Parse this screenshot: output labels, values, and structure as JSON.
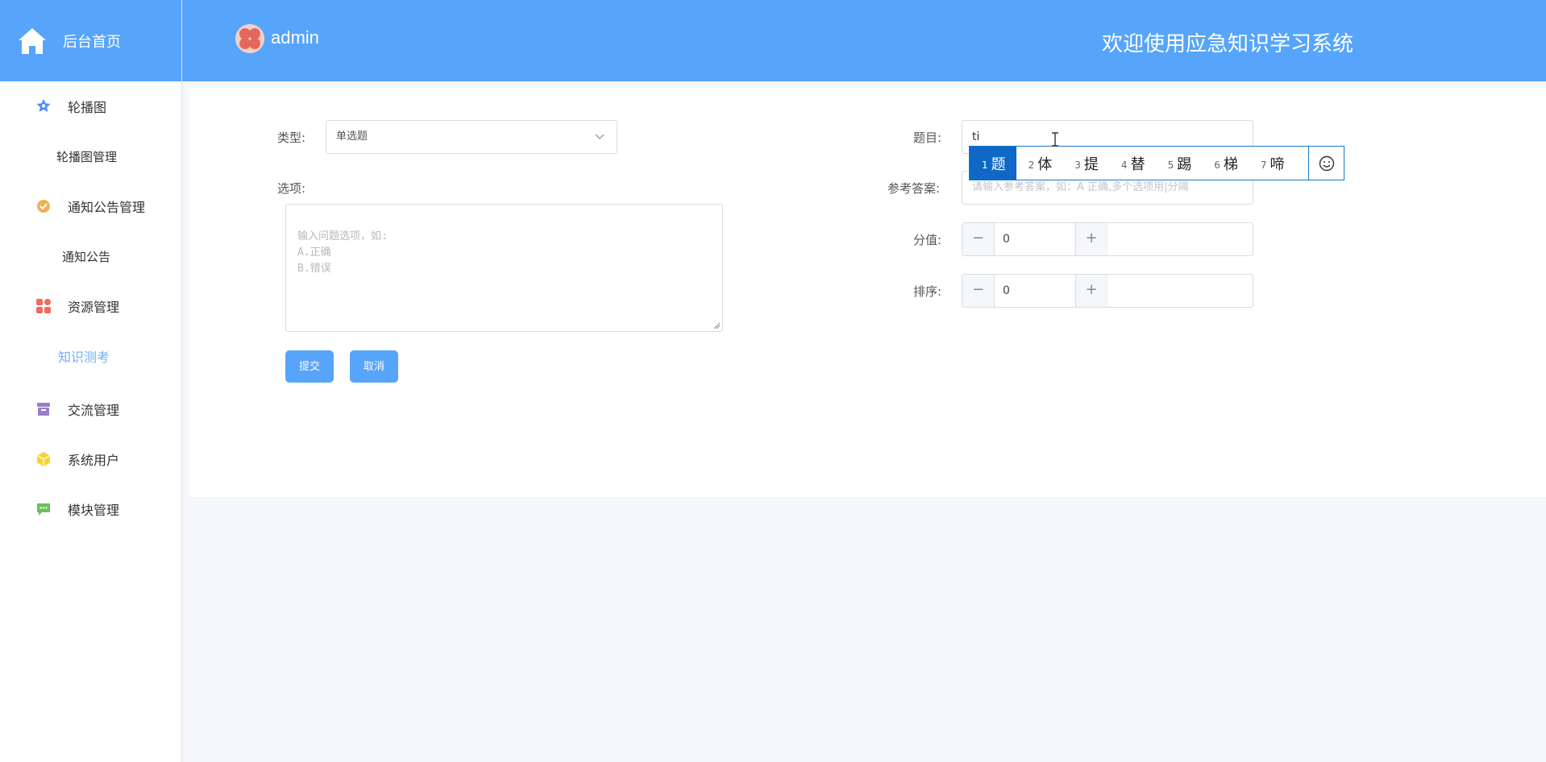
{
  "sidebar": {
    "home_label": "后台首页",
    "items": [
      {
        "label": "轮播图",
        "icon": "star-badge-icon",
        "color": "#4b8df8"
      },
      {
        "label": "轮播图管理",
        "sub": true
      },
      {
        "label": "通知公告管理",
        "icon": "gear-badge-icon",
        "color": "#f0b054"
      },
      {
        "label": "通知公告",
        "sub": true
      },
      {
        "label": "资源管理",
        "icon": "grid-apps-icon",
        "color": "#f06a5c"
      },
      {
        "label": "知识测考",
        "sub": true,
        "active": true
      },
      {
        "label": "交流管理",
        "icon": "archive-box-icon",
        "color": "#9a7fc8"
      },
      {
        "label": "系统用户",
        "icon": "cube-icon",
        "color": "#f5d631"
      },
      {
        "label": "模块管理",
        "icon": "chat-bubble-icon",
        "color": "#6ac259"
      }
    ]
  },
  "header": {
    "username": "admin",
    "welcome": "欢迎使用应急知识学习系统"
  },
  "form": {
    "type_label": "类型:",
    "type_value": "单选题",
    "options_label": "选项:",
    "options_placeholder": "输入问题选项，如:\nA.正确\nB.错误",
    "submit": "提交",
    "cancel": "取消",
    "question_label": "题目:",
    "question_value": "ti",
    "answer_label": "参考答案:",
    "answer_placeholder": "请输入参考答案，如：A 正确,多个选项用|分隔",
    "score_label": "分值:",
    "score_value": "0",
    "order_label": "排序:",
    "order_value": "0"
  },
  "ime": {
    "candidates": [
      {
        "n": "1",
        "ch": "题"
      },
      {
        "n": "2",
        "ch": "体"
      },
      {
        "n": "3",
        "ch": "提"
      },
      {
        "n": "4",
        "ch": "替"
      },
      {
        "n": "5",
        "ch": "踢"
      },
      {
        "n": "6",
        "ch": "梯"
      },
      {
        "n": "7",
        "ch": "啼"
      }
    ]
  },
  "colors": {
    "primary": "#57a5fb",
    "ime_selected": "#0f67c6"
  }
}
